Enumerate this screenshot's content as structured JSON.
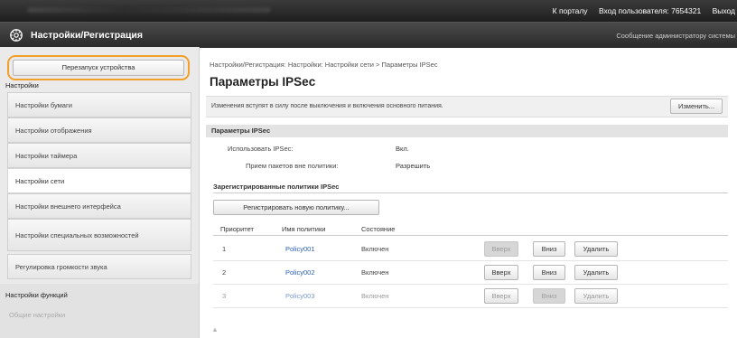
{
  "top_links": {
    "portal": "К порталу",
    "login": "Вход пользователя:",
    "user_id": "7654321",
    "logout": "Выход"
  },
  "app": {
    "title": "Настройки/Регистрация",
    "icon": "settings-gear-icon",
    "admin_message": "Сообщение администратору системы"
  },
  "sidebar": {
    "restart_button": "Перезапуск устройства",
    "heading": "Настройки",
    "items": [
      {
        "label": "Настройки бумаги",
        "active": false
      },
      {
        "label": "Настройки отображения",
        "active": false
      },
      {
        "label": "Настройки таймера",
        "active": false
      },
      {
        "label": "Настройки сети",
        "active": true
      },
      {
        "label": "Настройки внешнего интерфейса",
        "active": false
      },
      {
        "label": "Настройки специальных возможностей",
        "active": false
      },
      {
        "label": "Регулировка громкости звука",
        "active": false
      }
    ],
    "section2_heading": "Настройки функций",
    "section2_sub": "Общие настройки"
  },
  "main": {
    "breadcrumb": "Настройки/Регистрация: Настройки: Настройки сети > Параметры IPSec",
    "title": "Параметры IPSec",
    "notice": "Изменения вступят в силу после выключения и включения основного питания.",
    "edit_button": "Изменить...",
    "section_title": "Параметры IPSec",
    "use_ipsec_label": "Использовать IPSec:",
    "use_ipsec_value": "Вкл.",
    "non_policy_label": "Прием пакетов вне политики:",
    "non_policy_value": "Разрешить",
    "registered_heading": "Зарегистрированные политики IPSec",
    "register_button": "Регистрировать новую политику...",
    "columns": {
      "priority": "Приоритет",
      "name": "Имя политики",
      "status": "Состояние"
    },
    "rows": [
      {
        "priority": "1",
        "name": "Policy001",
        "status": "Включен",
        "up": "Вверх",
        "down": "Вниз",
        "delete": "Удалить",
        "up_disabled": true,
        "down_disabled": false,
        "delete_disabled": false,
        "faded": false
      },
      {
        "priority": "2",
        "name": "Policy002",
        "status": "Включен",
        "up": "Вверх",
        "down": "Вниз",
        "delete": "Удалить",
        "up_disabled": false,
        "down_disabled": false,
        "delete_disabled": false,
        "faded": false
      },
      {
        "priority": "3",
        "name": "Policy003",
        "status": "Включен",
        "up": "Вверх",
        "down": "Вниз",
        "delete": "Удалить",
        "up_disabled": false,
        "down_disabled": true,
        "delete_disabled": false,
        "faded": true
      }
    ],
    "footer_icon": "arrow-up-icon"
  },
  "colors": {
    "highlight": "#f2a02a",
    "link": "#2a5fb0",
    "header_bg": "#2a2a2a"
  }
}
